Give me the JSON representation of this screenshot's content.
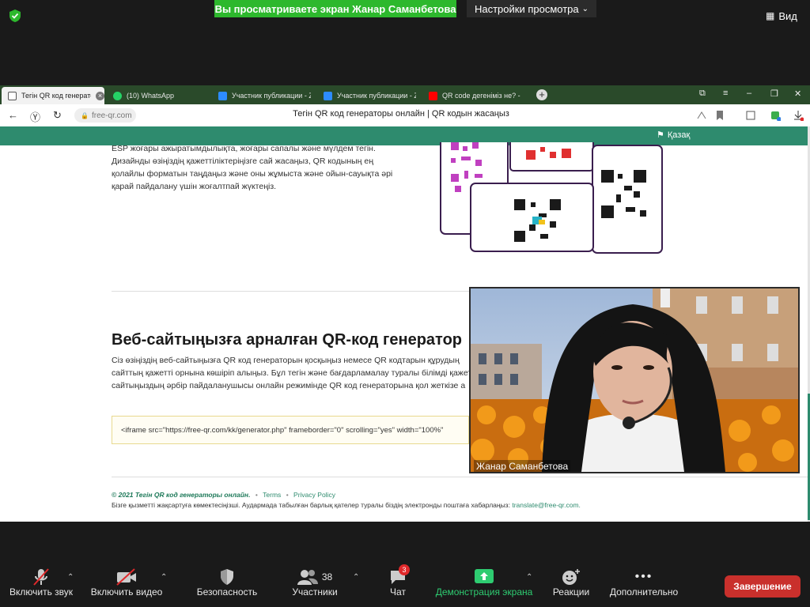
{
  "zoom_top": {
    "share_banner": "Вы просматриваете экран Жанар Саманбетова",
    "view_settings": "Настройки просмотра",
    "view_button": "Вид"
  },
  "browser": {
    "tabs": [
      {
        "label": "Тегін QR код генератор",
        "active": true
      },
      {
        "label": "(10) WhatsApp",
        "active": false
      },
      {
        "label": "Участник публикации - Zo",
        "active": false
      },
      {
        "label": "Участник публикации - Zo",
        "active": false
      },
      {
        "label": "QR code дегеніміз не? - Yo",
        "active": false
      }
    ],
    "url": "free-qr.com",
    "page_title": "Тегін QR код генераторы онлайн | QR кодын жасаңыз"
  },
  "page": {
    "language": "Қазақ",
    "intro_lines": [
      "ESP жоғары ажыратымдылықта, жоғары сапалы және мүлдем тегін.",
      "Дизайнды өзіңіздің қажеттіліктеріңізге сай жасаңыз, QR кодының ең",
      "қолайлы форматын таңдаңыз және оны жұмыста және ойын-сауықта әрі",
      "қарай пайдалану үшін жоғалтпай жүктеңіз."
    ],
    "section_heading": "Веб-сайтыңызға арналған QR-код генератор",
    "section_lines": [
      "Сіз өзіңіздің веб-сайтыңызға QR код генераторын қосқыңыз немесе QR кодтарын құрудың",
      "сайттың қажетті орнына көшіріп алыңыз. Бұл тегін және бағдарламалау туралы білімді қажет",
      "сайтыңыздың әрбір пайдаланушысы онлайн режимінде QR код генераторына қол жеткізе а"
    ],
    "embed_code": "<iframe src=\"https://free-qr.com/kk/generator.php\" frameborder=\"0\" scrolling=\"yes\" width=\"100%\"",
    "footer": {
      "copyright": "© 2021 Тегін QR код генераторы онлайн.",
      "sep": "•",
      "terms": "Terms",
      "privacy": "Privacy Policy",
      "help_text": "Бізге қызметті жақсартуға көмектесіңізші. Аудармада табылған барлық қателер туралы біздің электронды поштаға хабарлаңыз:",
      "email": "translate@free-qr.com."
    }
  },
  "video": {
    "participant_name": "Жанар Саманбетова"
  },
  "toolbar": {
    "mute": "Включить звук",
    "video": "Включить видео",
    "security": "Безопасность",
    "participants": "Участники",
    "participants_count": "38",
    "chat": "Чат",
    "chat_badge": "3",
    "share": "Демонстрация экрана",
    "reactions": "Реакции",
    "more": "Дополнительно",
    "end": "Завершение"
  },
  "colors": {
    "share_green": "#2db82d",
    "site_green": "#2e8b6e",
    "end_red": "#c9302c"
  }
}
